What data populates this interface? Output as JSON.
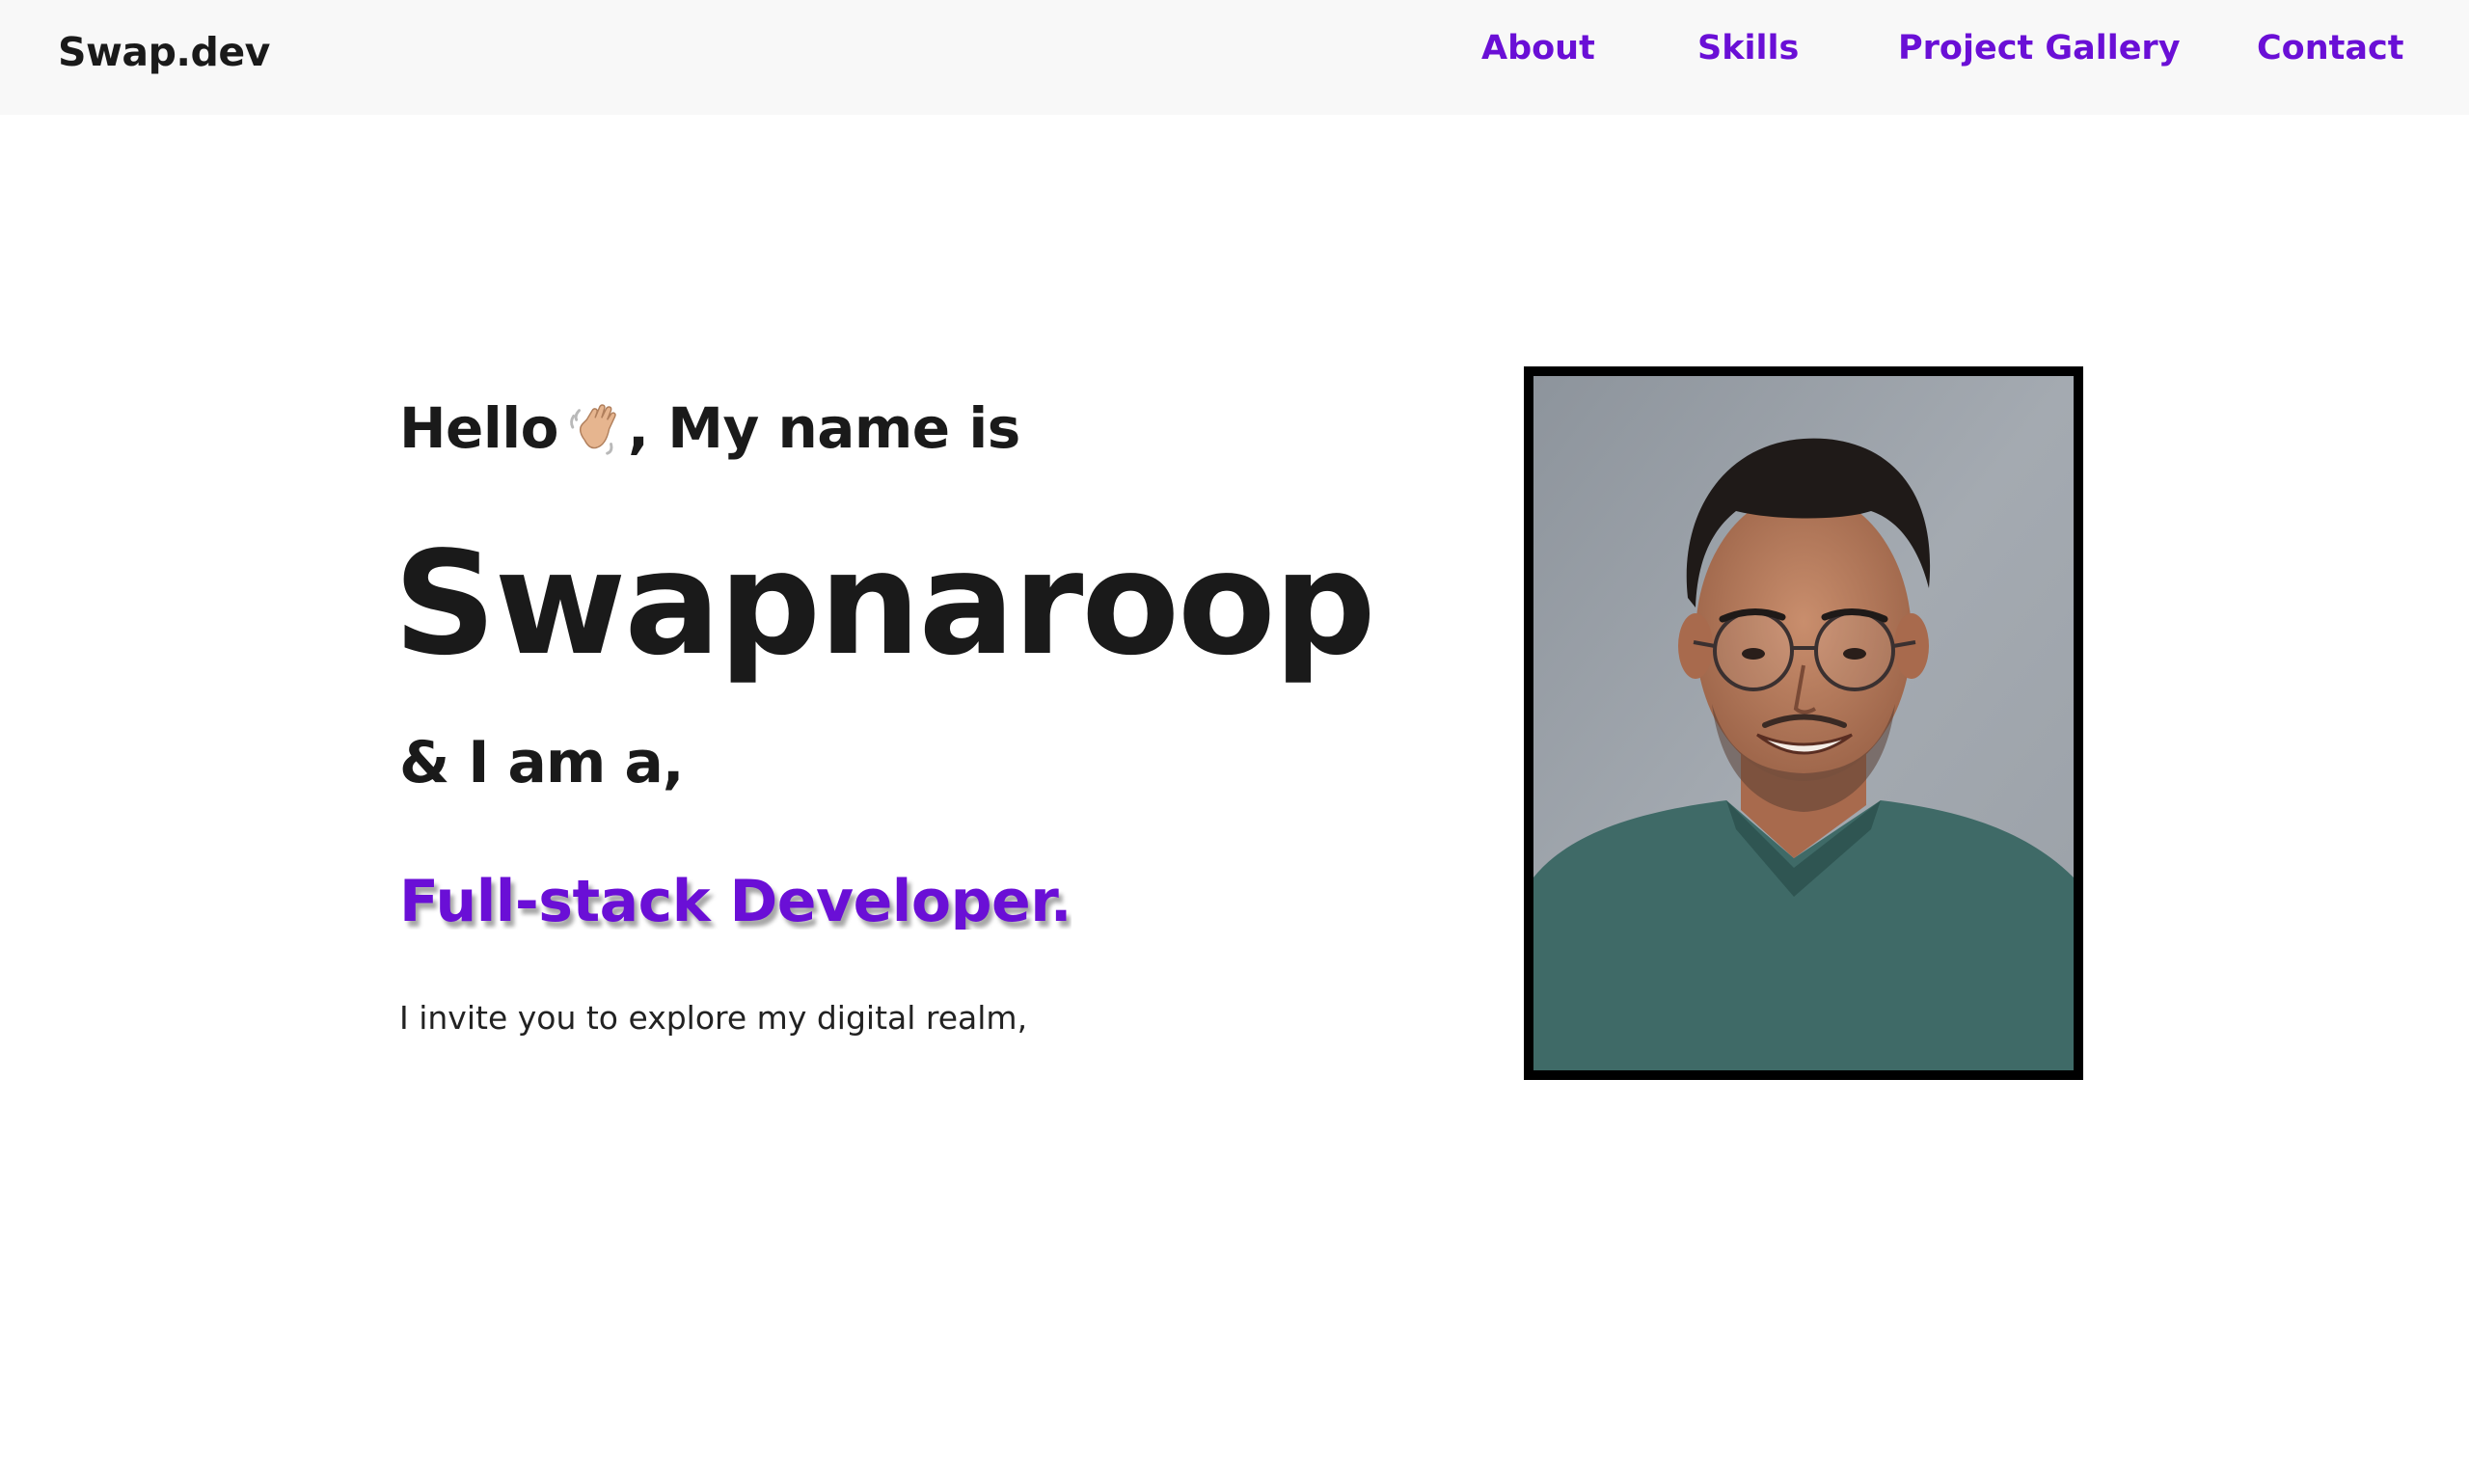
{
  "navbar": {
    "brand": "Swap.dev",
    "links": [
      "About",
      "Skills",
      "Project Gallery",
      "Contact"
    ]
  },
  "hero": {
    "greeting_before": "Hello",
    "greeting_after": ", My name is",
    "wave_icon": "waving-hand-icon",
    "name": "Swapnaroop",
    "intro": "& I am a,",
    "role": "Full-stack Developer.",
    "invite": "I invite you to explore my digital realm,"
  },
  "colors": {
    "accent": "#6a0fd6",
    "text": "#1a1a1a",
    "navbar_bg": "#f8f8f8",
    "frame": "#000000"
  }
}
